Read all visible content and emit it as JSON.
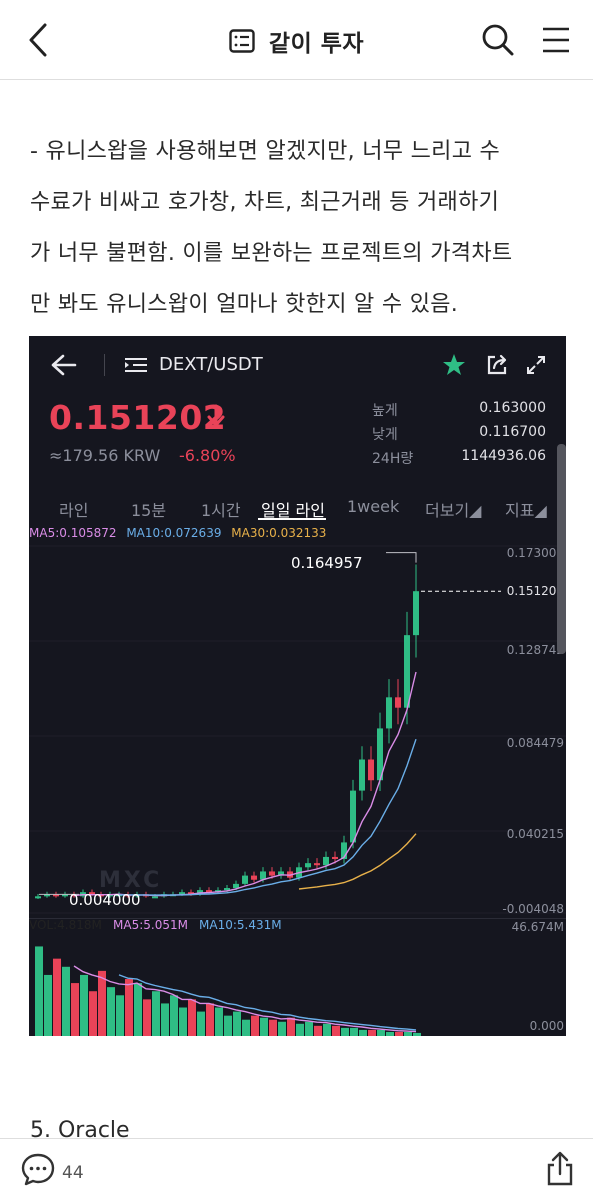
{
  "header": {
    "title": "같이 투자",
    "back_icon": "chevron-left-icon",
    "post_icon": "list-document-icon",
    "search_icon": "search-icon",
    "menu_icon": "hamburger-menu-icon"
  },
  "article": {
    "lines": [
      "- 유니스왑을 사용해보면 알겠지만, 너무 느리고 수",
      "수료가 비싸고 호가창, 차트, 최근거래 등 거래하기",
      "가 너무 불편함. 이를 보완하는 프로젝트의 가격차트",
      "만 봐도 유니스왑이 얼마나 핫한지 알 수 있음."
    ],
    "next_heading": "5. Oracle"
  },
  "trading": {
    "pair": "DEXT/USDT",
    "price": "0.151202",
    "krw": "≈179.56 KRW",
    "change": "-6.80%",
    "stats": [
      {
        "label": "높게",
        "value": "0.163000"
      },
      {
        "label": "낮게",
        "value": "0.116700"
      },
      {
        "label": "24H량",
        "value": "1144936.06"
      }
    ],
    "tabs": [
      "라인",
      "15분",
      "1시간",
      "일일 라인",
      "1week",
      "더보기◢",
      "지표◢"
    ],
    "active_tab": "일일 라인",
    "ma_row": {
      "ma5": "MA5:0.105872",
      "ma10": "MA10:0.072639",
      "ma30": "MA30:0.032133"
    },
    "price_axis": [
      "0.173005",
      "0.151202",
      "0.128742",
      "0.084479",
      "0.040215",
      "-0.004048"
    ],
    "high_marker": "0.164957",
    "low_marker": "0.004000",
    "volume_row": {
      "vol": "VOL:4.818M",
      "ma5": "MA5:5.051M",
      "ma10": "MA10:5.431M"
    },
    "volume_axis": [
      "46.674M",
      "0.000"
    ],
    "watermark": "MXC",
    "colors": {
      "up": "#2fbd85",
      "down": "#e94358",
      "ma5": "#d98ce6",
      "ma10": "#6aaee8",
      "ma30": "#e8b14a",
      "bg": "#15161f"
    }
  },
  "chart_data": {
    "type": "candlestick",
    "title": "DEXT/USDT",
    "candles_close": [
      0.004,
      0.005,
      0.004,
      0.005,
      0.004,
      0.006,
      0.005,
      0.004,
      0.005,
      0.005,
      0.004,
      0.005,
      0.004,
      0.004,
      0.005,
      0.005,
      0.006,
      0.005,
      0.007,
      0.006,
      0.007,
      0.008,
      0.01,
      0.014,
      0.012,
      0.016,
      0.014,
      0.016,
      0.013,
      0.018,
      0.02,
      0.019,
      0.023,
      0.022,
      0.03,
      0.055,
      0.07,
      0.06,
      0.085,
      0.1,
      0.095,
      0.13,
      0.151202
    ],
    "ylim": [
      -0.004048,
      0.173005
    ],
    "high": 0.164957,
    "low": 0.004,
    "volume_ylim": [
      0,
      46.674
    ]
  },
  "footer": {
    "comments": "44",
    "comment_icon": "speech-bubble-icon",
    "share_icon": "share-icon"
  }
}
